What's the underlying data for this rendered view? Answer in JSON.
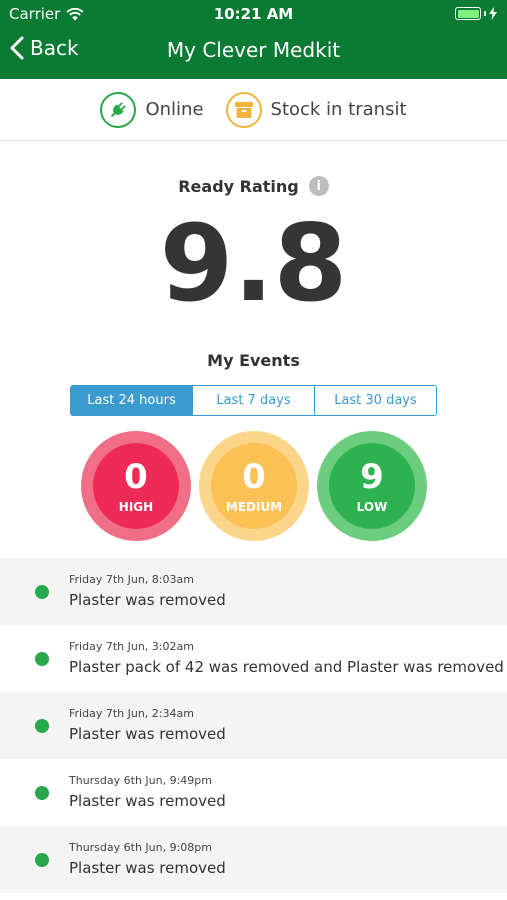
{
  "status_bar": {
    "carrier": "Carrier",
    "time": "10:21 AM"
  },
  "nav": {
    "back_label": "Back",
    "title": "My Clever Medkit"
  },
  "device_status": [
    {
      "label": "Online",
      "icon": "plug-icon",
      "color": "#27a84a"
    },
    {
      "label": "Stock in transit",
      "icon": "box-icon",
      "color": "#f0b43c"
    }
  ],
  "ready": {
    "label": "Ready Rating",
    "info": "i",
    "value": "9.8"
  },
  "events": {
    "title": "My Events",
    "tabs": [
      {
        "label": "Last 24 hours",
        "active": true
      },
      {
        "label": "Last 7 days",
        "active": false
      },
      {
        "label": "Last 30 days",
        "active": false
      }
    ],
    "counters": [
      {
        "label": "HIGH",
        "value": "0",
        "outer": "#f06f86",
        "inner": "#ee2a56"
      },
      {
        "label": "MEDIUM",
        "value": "0",
        "outer": "#fbd58a",
        "inner": "#fcc155"
      },
      {
        "label": "LOW",
        "value": "9",
        "outer": "#6dcd7f",
        "inner": "#2eb24f"
      }
    ],
    "items": [
      {
        "time": "Friday 7th Jun, 8:03am",
        "text": "Plaster was removed"
      },
      {
        "time": "Friday 7th Jun, 3:02am",
        "text": "Plaster pack of 42 was removed and Plaster was removed"
      },
      {
        "time": "Friday 7th Jun, 2:34am",
        "text": "Plaster was removed"
      },
      {
        "time": "Thursday 6th Jun, 9:49pm",
        "text": "Plaster was removed"
      },
      {
        "time": "Thursday 6th Jun, 9:08pm",
        "text": "Plaster was removed"
      }
    ]
  },
  "colors": {
    "header": "#0b7a32",
    "accent": "#3a9bd0",
    "event_dot": "#27a84a"
  }
}
